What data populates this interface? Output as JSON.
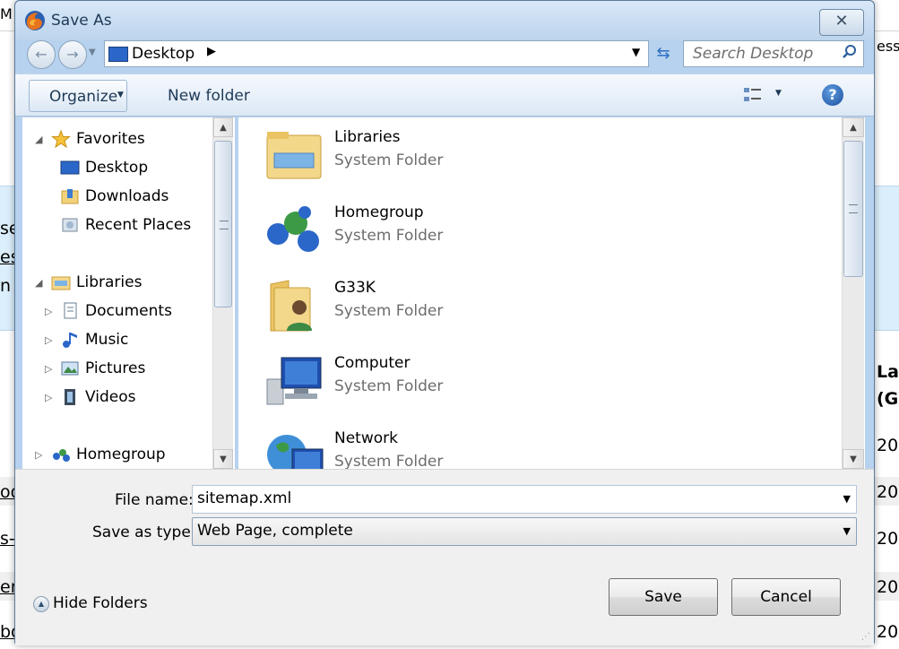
{
  "background_page": {
    "top_left_fragment": "M",
    "top_right_fragment": "ess",
    "left_fragments": [
      "se",
      "es",
      "n"
    ],
    "right_header": [
      "Las",
      "(GI"
    ],
    "rows": [
      {
        "left": "",
        "right": "20"
      },
      {
        "left": "od",
        "right": "20"
      },
      {
        "left": "s-",
        "right": "20"
      },
      {
        "left": "en",
        "right": "20"
      },
      {
        "left": "bo",
        "right": "20"
      }
    ]
  },
  "dialog": {
    "title": "Save As",
    "close_glyph": "✕",
    "address": {
      "location": "Desktop",
      "separator": "▶",
      "dropdown": "▼"
    },
    "search": {
      "placeholder": "Search Desktop"
    },
    "toolbar": {
      "organize": "Organize",
      "new_folder": "New folder",
      "help": "?"
    },
    "nav_tree": [
      {
        "label": "Favorites",
        "icon": "star-icon",
        "level": 0,
        "expander": "◢"
      },
      {
        "label": "Desktop",
        "icon": "desktop-icon",
        "level": 1,
        "expander": ""
      },
      {
        "label": "Downloads",
        "icon": "downloads-folder-icon",
        "level": 1,
        "expander": ""
      },
      {
        "label": "Recent Places",
        "icon": "recent-places-icon",
        "level": 1,
        "expander": ""
      },
      {
        "label": "Libraries",
        "icon": "libraries-icon",
        "level": 0,
        "expander": "◢"
      },
      {
        "label": "Documents",
        "icon": "documents-icon",
        "level": 1,
        "expander": "▷"
      },
      {
        "label": "Music",
        "icon": "music-icon",
        "level": 1,
        "expander": "▷"
      },
      {
        "label": "Pictures",
        "icon": "pictures-icon",
        "level": 1,
        "expander": "▷"
      },
      {
        "label": "Videos",
        "icon": "videos-icon",
        "level": 1,
        "expander": "▷"
      },
      {
        "label": "Homegroup",
        "icon": "homegroup-icon",
        "level": 0,
        "expander": "▷"
      }
    ],
    "items": [
      {
        "name": "Libraries",
        "type": "System Folder",
        "icon": "libraries-folder-icon"
      },
      {
        "name": "Homegroup",
        "type": "System Folder",
        "icon": "homegroup-icon"
      },
      {
        "name": "G33K",
        "type": "System Folder",
        "icon": "user-folder-icon"
      },
      {
        "name": "Computer",
        "type": "System Folder",
        "icon": "computer-icon"
      },
      {
        "name": "Network",
        "type": "System Folder",
        "icon": "network-icon"
      }
    ],
    "file_name_label": "File name:",
    "file_name_value": "sitemap.xml",
    "save_type_label": "Save as type:",
    "save_type_value": "Web Page, complete",
    "hide_folders": "Hide Folders",
    "save_button": "Save",
    "cancel_button": "Cancel",
    "colors": {
      "accent": "#2b67c8",
      "title_bar": "#bcd4ec",
      "background_band": "#dbeefb"
    }
  }
}
